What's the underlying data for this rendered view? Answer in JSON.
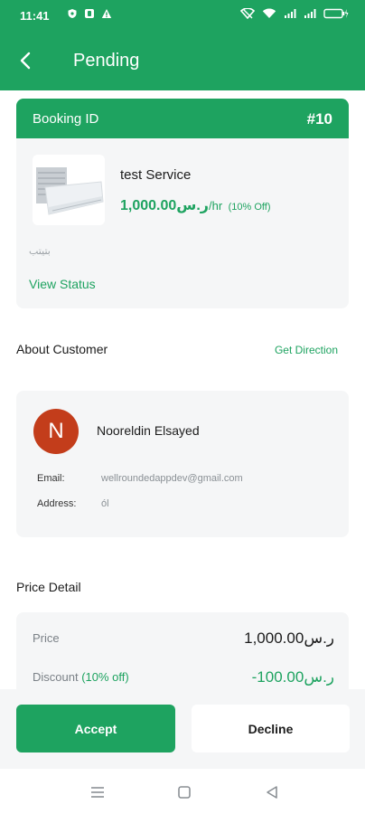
{
  "status_bar": {
    "time": "11:41",
    "left_icons": [
      "shield-icon",
      "app-icon",
      "warning-icon"
    ],
    "right_icons": [
      "hotspot-icon",
      "wifi-icon",
      "signal-icon",
      "signal-icon",
      "battery-icon"
    ]
  },
  "app_bar": {
    "title": "Pending",
    "back_icon": "chevron-left-icon"
  },
  "booking": {
    "id_label": "Booking ID",
    "id_value": "#10",
    "service_name": "test Service",
    "price": "1,000.00ر.س",
    "price_unit": "/hr",
    "discount_badge": "(10% Off)",
    "description": "بتيتب",
    "view_status_label": "View Status"
  },
  "about_customer": {
    "title": "About Customer",
    "get_direction_label": "Get Direction"
  },
  "customer": {
    "initial": "N",
    "name": "Nooreldin Elsayed",
    "email_label": "Email:",
    "email": "wellroundedappdev@gmail.com",
    "address_label": "Address:",
    "address": "ól"
  },
  "price_detail": {
    "title": "Price Detail",
    "price_label": "Price",
    "price_value": "1,000.00ر.س",
    "discount_label": "Discount",
    "discount_pct": "(10% off)",
    "discount_value": "-100.00ر.س"
  },
  "actions": {
    "accept_label": "Accept",
    "decline_label": "Decline"
  },
  "nav": {
    "icons": [
      "menu-icon",
      "home-square-icon",
      "back-triangle-icon"
    ]
  },
  "colors": {
    "brand": "#1ea360",
    "avatar": "#c33d1b",
    "card_bg": "#f5f6f7"
  }
}
